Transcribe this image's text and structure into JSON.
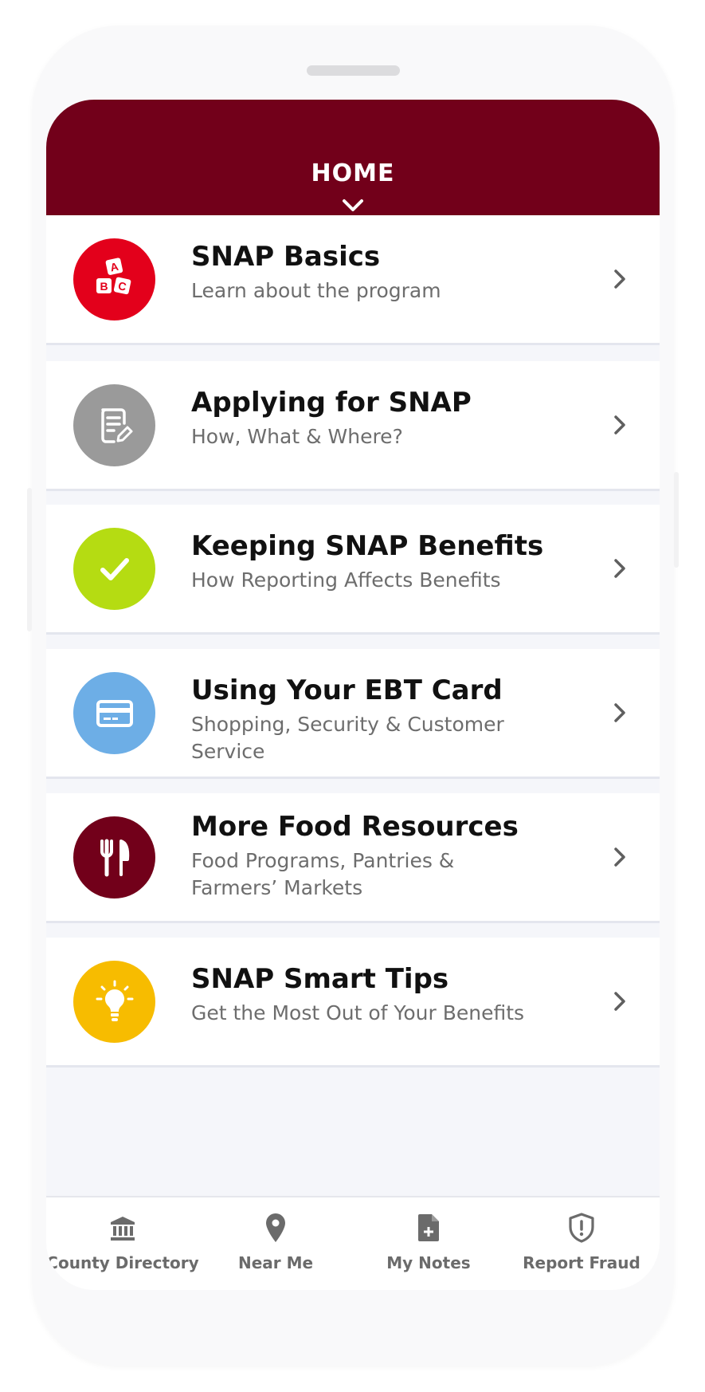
{
  "header": {
    "title": "HOME"
  },
  "menu": [
    {
      "title": "SNAP Basics",
      "subtitle": "Learn about the program",
      "icon": "abc-blocks-icon",
      "color": "#e3001b"
    },
    {
      "title": "Applying for SNAP",
      "subtitle": "How, What & Where?",
      "icon": "document-edit-icon",
      "color": "#9a9a9a"
    },
    {
      "title": "Keeping SNAP Benefits",
      "subtitle": "How Reporting Affects Benefits",
      "icon": "checkmark-icon",
      "color": "#b5dc12"
    },
    {
      "title": "Using Your EBT Card",
      "subtitle": "Shopping, Security & Customer Service",
      "icon": "credit-card-icon",
      "color": "#6daee6"
    },
    {
      "title": "More Food Resources",
      "subtitle": "Food Programs, Pantries & Farmers’ Markets",
      "icon": "fork-knife-icon",
      "color": "#72001a"
    },
    {
      "title": "SNAP Smart Tips",
      "subtitle": "Get the Most Out of  Your Benefits",
      "icon": "lightbulb-icon",
      "color": "#f7bc00"
    }
  ],
  "tabbar": [
    {
      "label": "County Directory",
      "icon": "government-building-icon"
    },
    {
      "label": "Near Me",
      "icon": "map-pin-icon"
    },
    {
      "label": "My Notes",
      "icon": "note-add-icon"
    },
    {
      "label": "Report Fraud",
      "icon": "shield-alert-icon"
    }
  ],
  "colors": {
    "brand": "#72001a",
    "background": "#f5f6fa"
  }
}
